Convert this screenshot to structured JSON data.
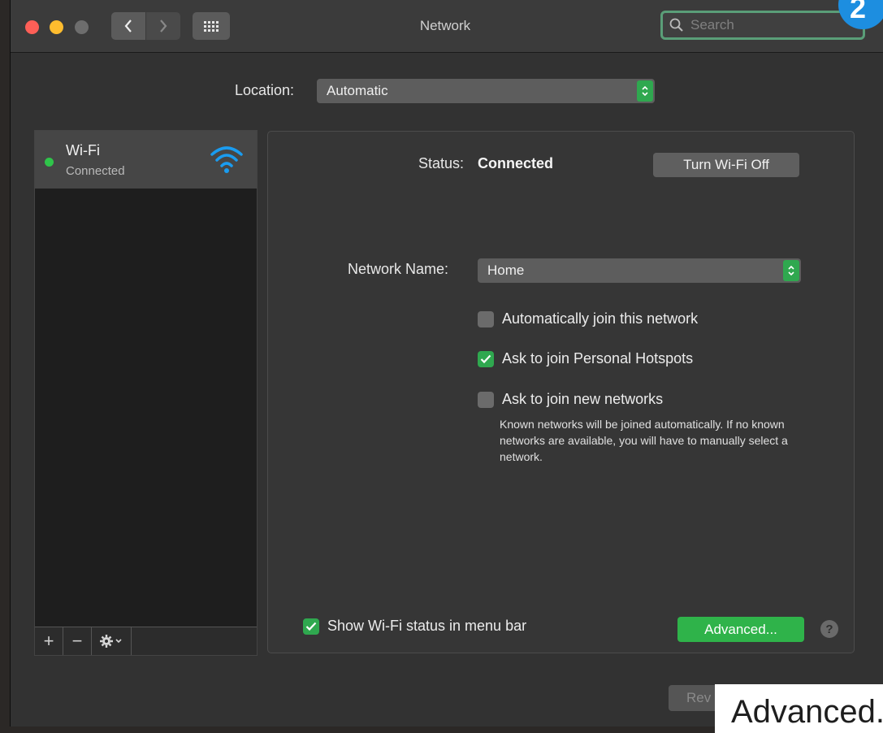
{
  "window": {
    "title": "Network",
    "search_placeholder": "Search",
    "badge": "2"
  },
  "location": {
    "label": "Location:",
    "value": "Automatic"
  },
  "services": [
    {
      "name": "Wi-Fi",
      "status": "Connected"
    }
  ],
  "sidebar_footer": {
    "add": "+",
    "remove": "−"
  },
  "detail": {
    "status_label": "Status:",
    "status_value": "Connected",
    "wifi_off_button": "Turn Wi-Fi Off",
    "network_name_label": "Network Name:",
    "network_name_value": "Home",
    "auto_join": {
      "label": "Automatically join this network",
      "checked": false
    },
    "personal_hotspots": {
      "label": "Ask to join Personal Hotspots",
      "checked": true
    },
    "new_networks": {
      "label": "Ask to join new networks",
      "checked": false
    },
    "note": "Known networks will be joined automatically. If no known networks are available, you will have to manually select a network.",
    "show_status": {
      "label": "Show Wi-Fi status in menu bar",
      "checked": true
    },
    "advanced_button": "Advanced...",
    "help": "?"
  },
  "revert_button": "Rev",
  "callout_text": "Advanced.",
  "colors": {
    "accent_green": "#2fb34a",
    "search_focus": "#5a9e78",
    "badge_blue": "#1d8ee0"
  }
}
